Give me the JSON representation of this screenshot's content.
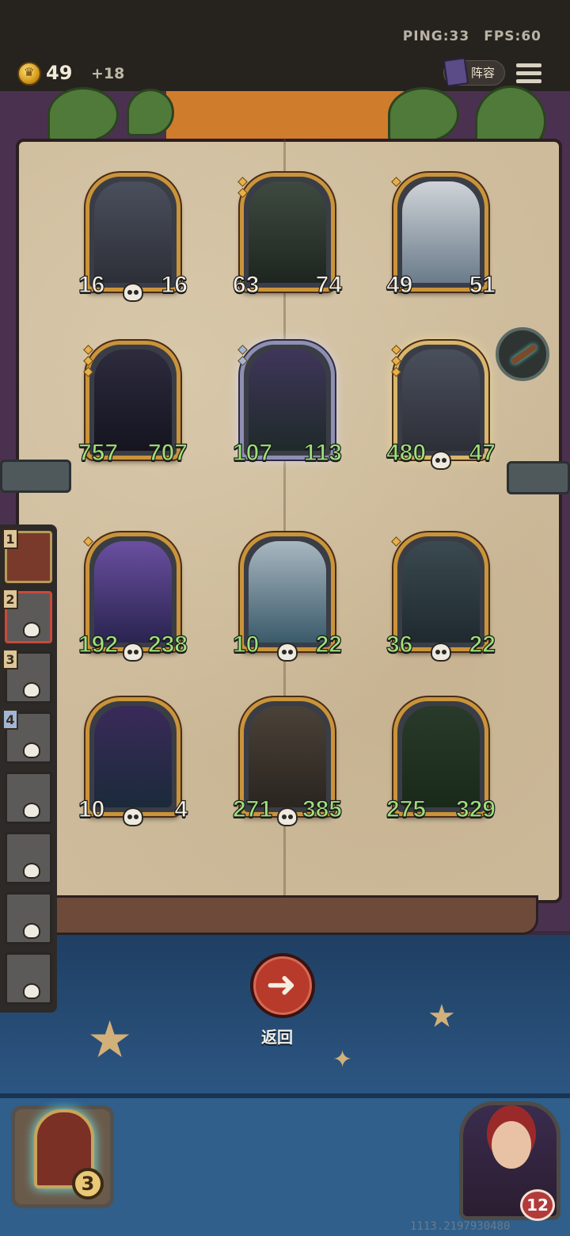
{
  "status": {
    "ping": "PING:33",
    "fps": "FPS:60"
  },
  "gold": {
    "amount": "49",
    "income": "+18"
  },
  "toolbar": {
    "lineup_label": "阵容"
  },
  "cards": [
    {
      "attack": "16",
      "health": "16",
      "attack_buff": false,
      "health_buff": false,
      "stars": 0,
      "deathrattle": true,
      "art": "skeleton-dragon"
    },
    {
      "attack": "63",
      "health": "74",
      "attack_buff": false,
      "health_buff": false,
      "stars": 2,
      "deathrattle": false,
      "art": "hooded-reaper"
    },
    {
      "attack": "49",
      "health": "51",
      "attack_buff": false,
      "health_buff": false,
      "stars": 1,
      "deathrattle": false,
      "art": "horned-beast"
    },
    {
      "attack": "757",
      "health": "707",
      "attack_buff": true,
      "health_buff": true,
      "stars": 3,
      "deathrattle": false,
      "art": "skeleton-axe"
    },
    {
      "attack": "107",
      "health": "113",
      "attack_buff": true,
      "health_buff": true,
      "stars": 2,
      "deathrattle": false,
      "art": "serpent",
      "silver": true
    },
    {
      "attack": "480",
      "health": "47",
      "attack_buff": true,
      "health_buff": true,
      "stars": 3,
      "deathrattle": true,
      "art": "skeleton-dragon-gold",
      "golden": true
    },
    {
      "attack": "192",
      "health": "238",
      "attack_buff": true,
      "health_buff": true,
      "stars": 1,
      "deathrattle": true,
      "art": "dark-sorceress"
    },
    {
      "attack": "10",
      "health": "22",
      "attack_buff": true,
      "health_buff": true,
      "stars": 0,
      "deathrattle": true,
      "art": "sea-dragon"
    },
    {
      "attack": "36",
      "health": "22",
      "attack_buff": true,
      "health_buff": true,
      "stars": 1,
      "deathrattle": true,
      "art": "ghost-priestess"
    },
    {
      "attack": "10",
      "health": "4",
      "attack_buff": false,
      "health_buff": false,
      "stars": 0,
      "deathrattle": true,
      "art": "spirit-cauldron"
    },
    {
      "attack": "271",
      "health": "385",
      "attack_buff": true,
      "health_buff": true,
      "stars": 0,
      "deathrattle": true,
      "art": "nun"
    },
    {
      "attack": "275",
      "health": "329",
      "attack_buff": true,
      "health_buff": true,
      "stars": 0,
      "deathrattle": false,
      "art": "pumpkin-golem"
    }
  ],
  "sidebar": [
    {
      "rank": "1",
      "active": true
    },
    {
      "rank": "2",
      "selected": true
    },
    {
      "rank": "3"
    },
    {
      "rank": "4"
    },
    {
      "rank": ""
    },
    {
      "rank": ""
    },
    {
      "rank": ""
    },
    {
      "rank": ""
    }
  ],
  "actions": {
    "return_label": "返回",
    "return_icon": "arrow-left-icon"
  },
  "tavern": {
    "level": "3"
  },
  "hero": {
    "health": "12"
  },
  "footer": {
    "build": "1113.2197930480"
  }
}
